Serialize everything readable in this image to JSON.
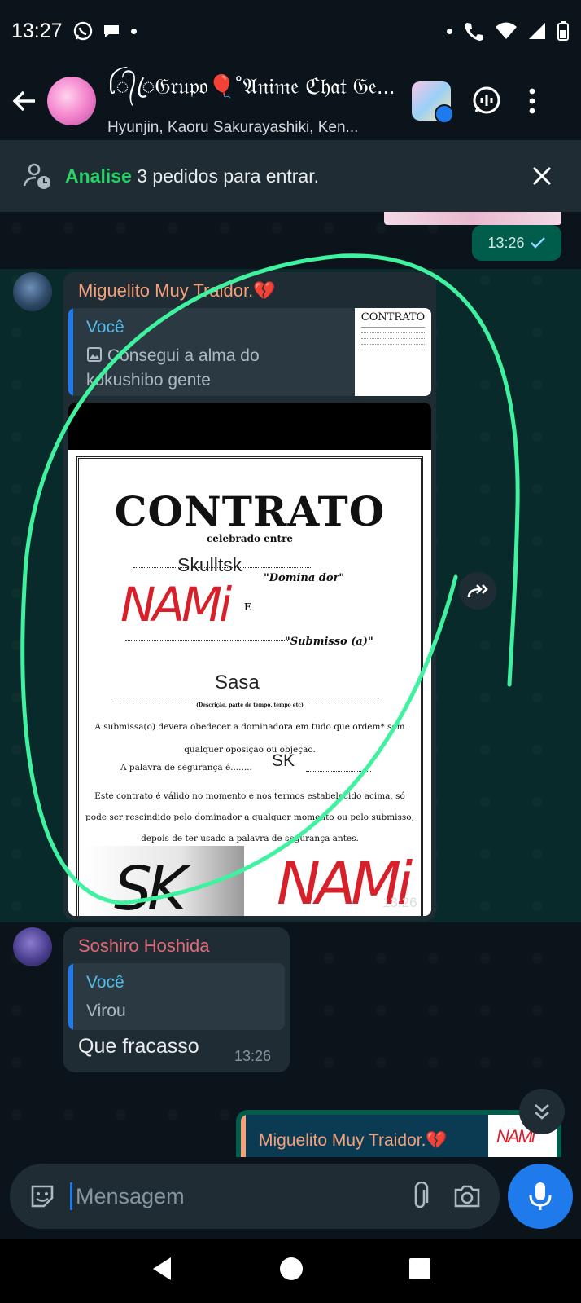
{
  "status_bar": {
    "time": "13:27"
  },
  "header": {
    "title": "ꪶ᭄ꦿ𝔊𝔯𝔲𝔭𝔬🎈˚𝔄𝔫𝔦𝔪𝔢 ℭ𝔥𝔞𝔱 𝔊𝔢...",
    "subtitle": "Hyunjin, Kaoru Sakurayashiki, Ken..."
  },
  "banner": {
    "accent": "Analise",
    "text": " 3 pedidos para entrar."
  },
  "messages": {
    "outgoing_time": "13:26",
    "msg1": {
      "sender": "Miguelito Muy Traidor.💔",
      "quote_author": "Você",
      "quote_text": "Consegui a alma do kokushibo gente",
      "time": "13:26",
      "contract": {
        "title": "CONTRATO",
        "subtitle": "celebrado entre",
        "name1": "Skulltsk",
        "role1": "\"Domina dor\"",
        "and": "E",
        "signature": "NAMi",
        "role2": "\"Submisso (a)\"",
        "name2": "Sasa",
        "small": "(Descrição, parte de tempo, tempo etc)",
        "clause1": "A submissa(o) devera obedecer a dominadora em tudo que ordem* sem qualquer oposição ou objeção.",
        "clause2_label": "A palavra de segurança é........",
        "safe_word": "SK",
        "clause3": "Este contrato é válido no momento e nos termos estabelecido acima, só pode ser rescindido pelo dominador a qualquer momento ou pelo submisso, depois de ter usado a palavra de segurança antes.",
        "sig_left": "SK",
        "sig_right": "NAMi",
        "thumb_title": "CONTRATO"
      }
    },
    "msg2": {
      "sender": "Soshiro Hoshida",
      "quote_author": "Você",
      "quote_text": "Virou",
      "text": "Que fracasso",
      "time": "13:26"
    },
    "msg3": {
      "quote_author": "Miguelito Muy Traidor.💔"
    }
  },
  "composer": {
    "placeholder": "Mensagem"
  },
  "colors": {
    "accent": "#25d366",
    "bubble_out": "#005c4b",
    "bubble_in": "#202c33",
    "brand_blue": "#1f7aec"
  }
}
